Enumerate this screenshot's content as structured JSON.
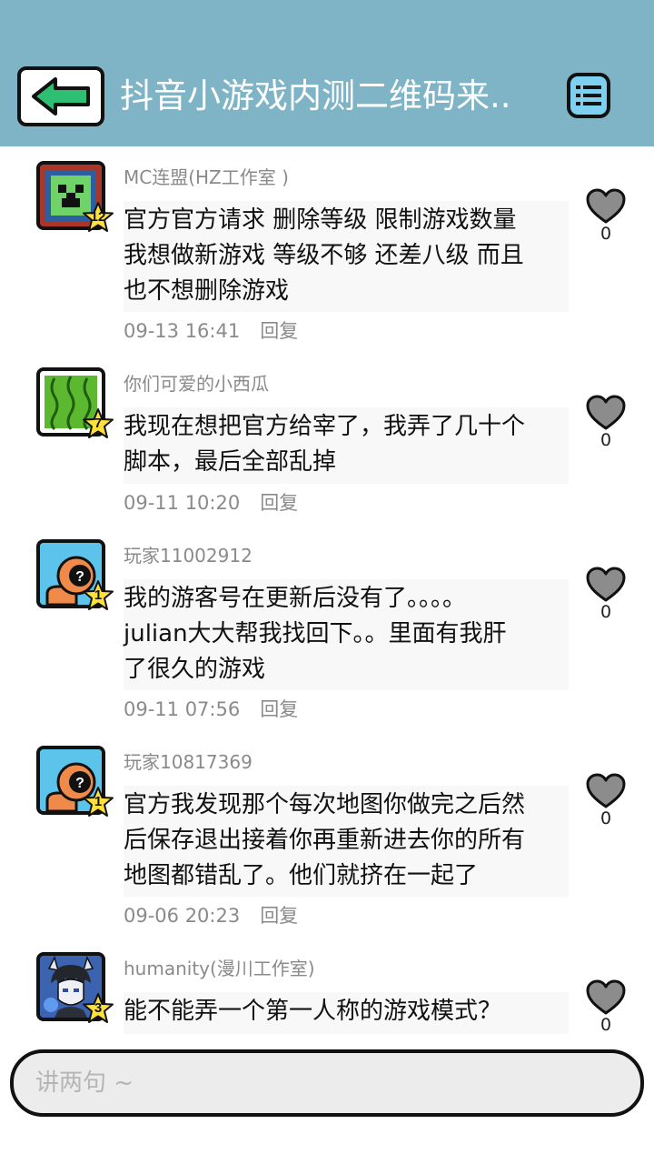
{
  "header": {
    "title": "抖音小游戏内测二维码来..",
    "back_icon": "back-arrow-icon",
    "menu_icon": "list-menu-icon",
    "colors": {
      "bar": "#7fb4c7",
      "back_arrow": "#2fbf73",
      "menu": "#7dd0f0"
    }
  },
  "comments": [
    {
      "username": "MC连盟(HZ工作室 )",
      "level": "12",
      "lines": [
        "官方官方请求 删除等级 限制游戏数量",
        "我想做新游戏 等级不够 还差八级 而且",
        "也不想删除游戏"
      ],
      "time": "09-13 16:41",
      "reply": "回复",
      "likes": "0"
    },
    {
      "username": "你们可爱的小西瓜",
      "level": "7",
      "lines": [
        "我现在想把官方给宰了，我弄了几十个",
        "脚本，最后全部乱掉"
      ],
      "time": "09-11 10:20",
      "reply": "回复",
      "likes": "0"
    },
    {
      "username": "玩家11002912",
      "level": "1",
      "lines": [
        "我的游客号在更新后没有了。。。。",
        "julian大大帮我找回下。。里面有我肝",
        "了很久的游戏"
      ],
      "time": "09-11 07:56",
      "reply": "回复",
      "likes": "0"
    },
    {
      "username": "玩家10817369",
      "level": "1",
      "lines": [
        "官方我发现那个每次地图你做完之后然",
        "后保存退出接着你再重新进去你的所有",
        "地图都错乱了。他们就挤在一起了"
      ],
      "time": "09-06 20:23",
      "reply": "回复",
      "likes": "0"
    },
    {
      "username": "humanity(漫川工作室)",
      "level": "3",
      "lines": [
        "能不能弄一个第一人称的游戏模式？"
      ],
      "time": "",
      "reply": "",
      "likes": "0"
    }
  ],
  "input": {
    "placeholder": "讲两句 ~"
  }
}
